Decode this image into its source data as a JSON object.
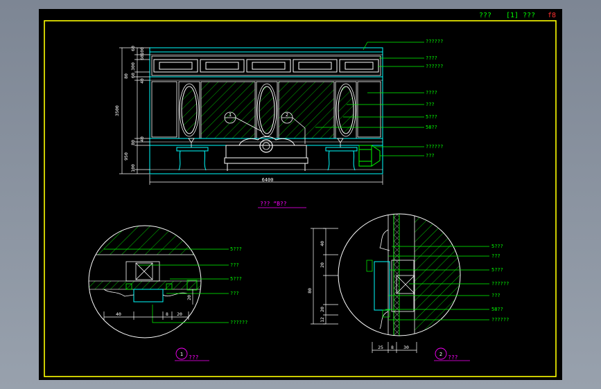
{
  "title_block": {
    "label_a": "???",
    "label_b": "[1] ???",
    "sheet_no": "f8"
  },
  "elevation": {
    "title": "???  ”B??",
    "leaders": [
      "??????",
      "????",
      "??????",
      "????",
      "???",
      "5???",
      "58??",
      "??????",
      "???"
    ],
    "dims_left": [
      "100",
      "60",
      "60",
      "300",
      "60",
      "80",
      "40",
      "3500",
      "40",
      "80",
      "100",
      "950"
    ],
    "dim_bottom": "6400",
    "callouts": [
      "1",
      "2"
    ]
  },
  "detail1": {
    "leaders": [
      "5???",
      "???",
      "5???",
      "???",
      "??????"
    ],
    "dims_bottom": [
      "40",
      "8",
      "20"
    ],
    "dim_side": "20",
    "label_num": "1",
    "label_text": "???"
  },
  "detail2": {
    "leaders": [
      "5???",
      "???",
      "5???",
      "??????",
      "???",
      "58??",
      "??????"
    ],
    "dims_left": [
      "40",
      "20",
      "80",
      "20",
      "12"
    ],
    "dims_bottom": [
      "25",
      "8",
      "30"
    ],
    "label_num": "2",
    "label_text": "???"
  },
  "colors": {
    "sheet": "#000000",
    "border": "#ffff00",
    "leaders": "#00ff00",
    "dims": "#ffffff",
    "outline": "#00ffff",
    "hatch": "#00ff00",
    "text_red": "#ff3030",
    "magenta": "#ff00ff"
  }
}
